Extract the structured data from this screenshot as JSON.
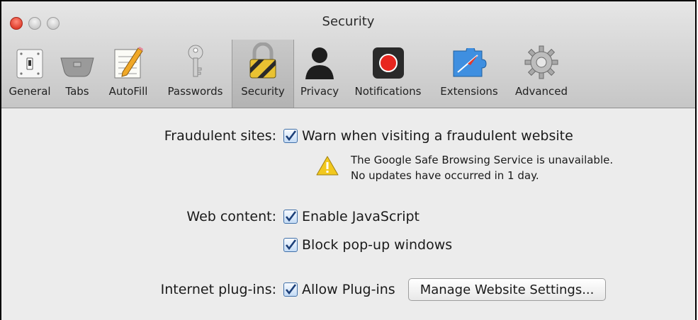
{
  "window": {
    "title": "Security"
  },
  "toolbar": {
    "tabs": [
      {
        "label": "General",
        "icon": "light-switch-icon"
      },
      {
        "label": "Tabs",
        "icon": "tabs-icon"
      },
      {
        "label": "AutoFill",
        "icon": "pencil-form-icon"
      },
      {
        "label": "Passwords",
        "icon": "key-icon"
      },
      {
        "label": "Security",
        "icon": "padlock-icon",
        "selected": true
      },
      {
        "label": "Privacy",
        "icon": "person-silhouette-icon"
      },
      {
        "label": "Notifications",
        "icon": "record-dot-icon"
      },
      {
        "label": "Extensions",
        "icon": "puzzle-compass-icon"
      },
      {
        "label": "Advanced",
        "icon": "gear-icon"
      }
    ]
  },
  "fraud": {
    "label": "Fraudulent sites:",
    "option": "Warn when visiting a fraudulent website",
    "checked": true,
    "warning_line1": "The Google Safe Browsing Service is unavailable.",
    "warning_line2": "No updates have occurred in 1 day."
  },
  "web": {
    "label": "Web content:",
    "js": "Enable JavaScript",
    "js_checked": true,
    "popup": "Block pop-up windows",
    "popup_checked": true
  },
  "plugins": {
    "label": "Internet plug-ins:",
    "option": "Allow Plug-ins",
    "checked": true,
    "manage_button": "Manage Website Settings..."
  },
  "colors": {
    "accent": "#2c6fc9",
    "warning": "#f2c81e",
    "record_red": "#e8261f"
  }
}
